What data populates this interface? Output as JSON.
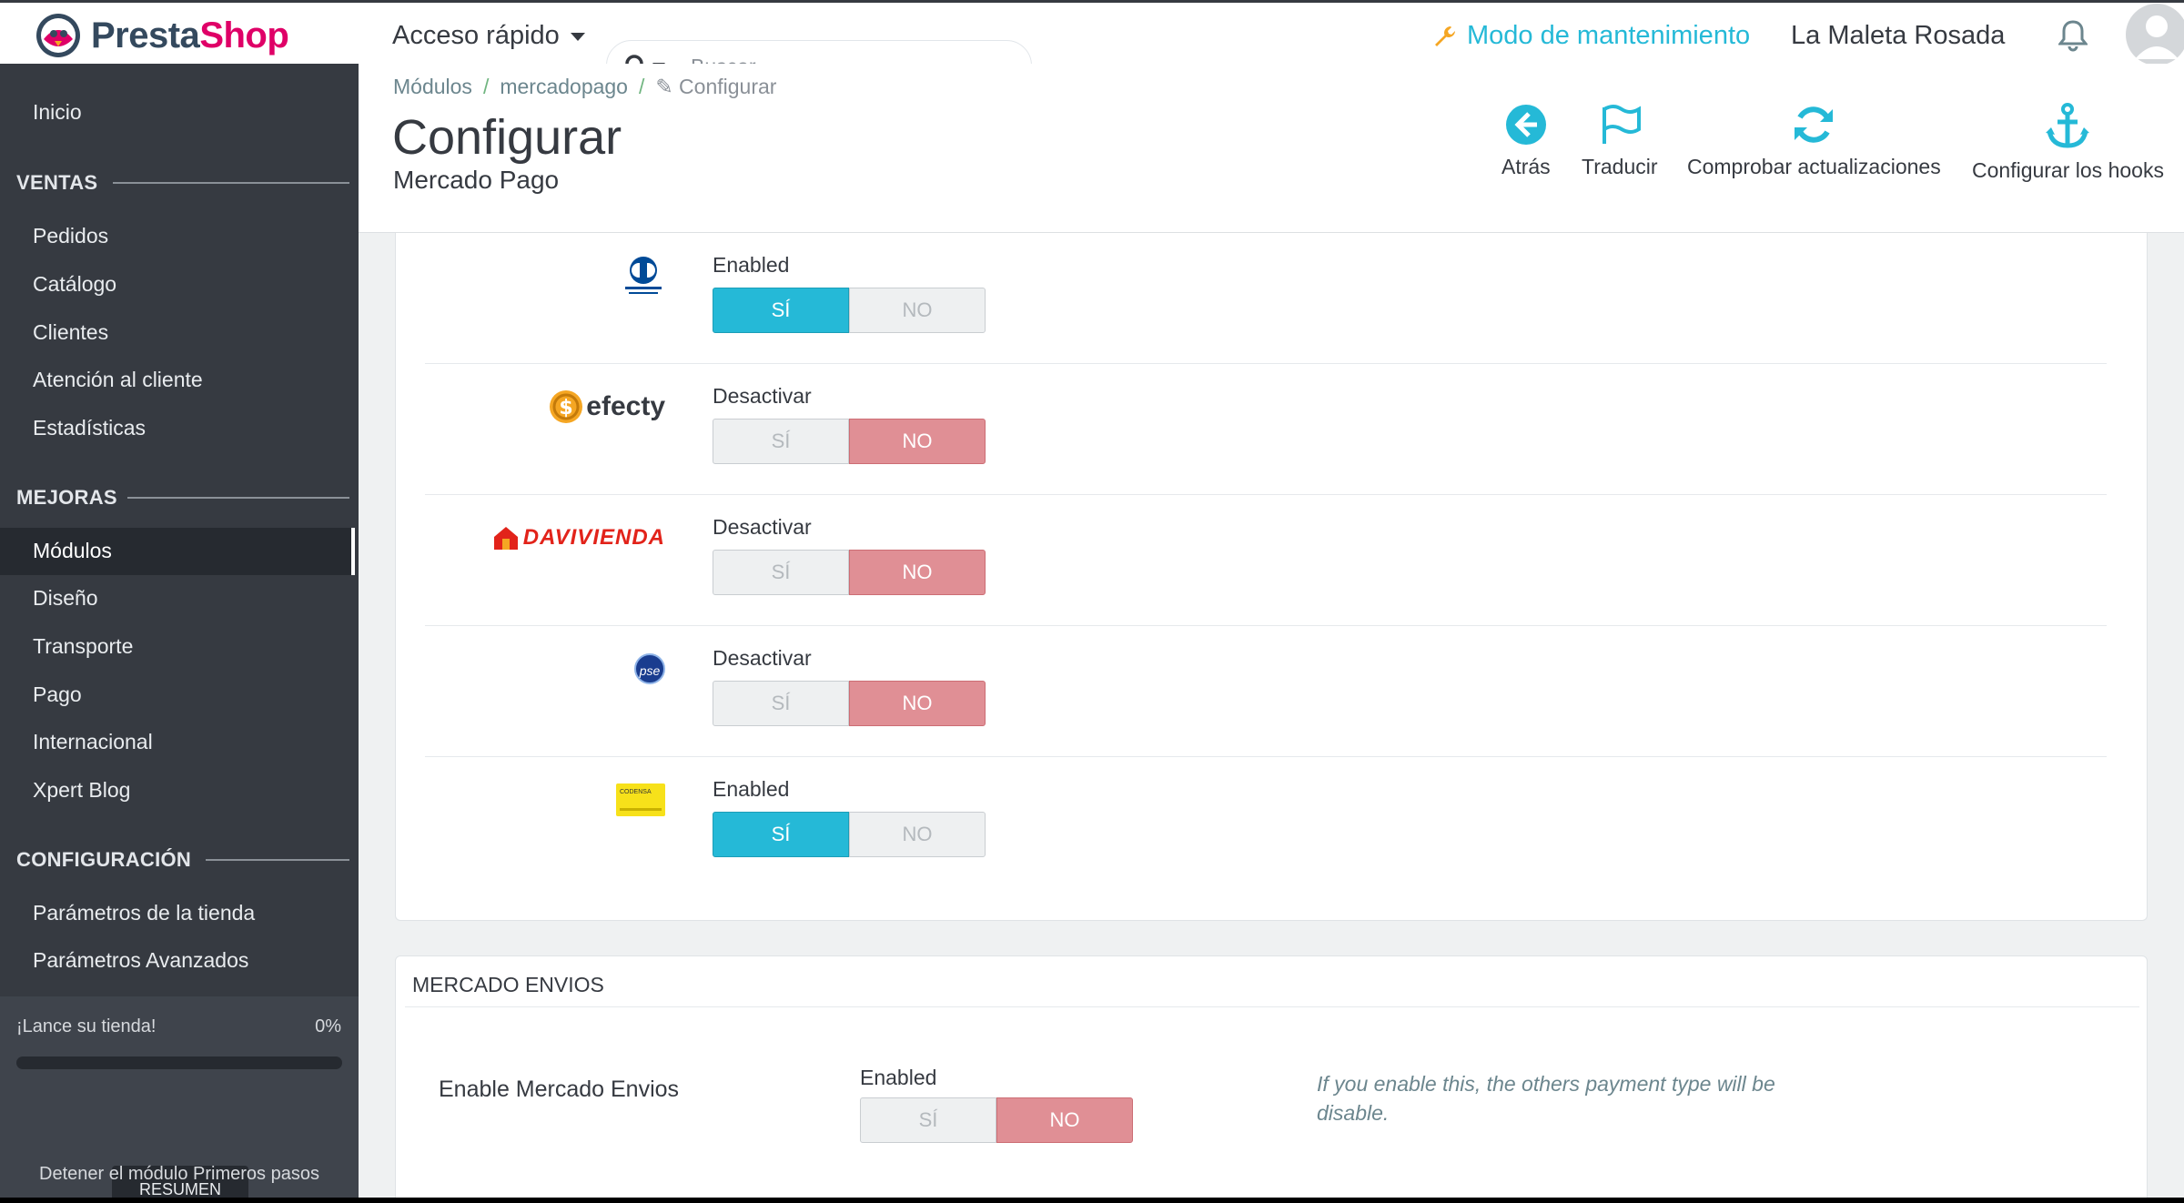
{
  "header": {
    "brand": {
      "part1": "Presta",
      "part2": "Shop"
    },
    "quick_access": "Acceso rápido",
    "search": {
      "placeholder": "Buscar"
    },
    "maintenance": "Modo de mantenimiento",
    "shop_name": "La Maleta Rosada"
  },
  "sidebar": {
    "home": "Inicio",
    "sections": [
      {
        "title": "VENTAS",
        "items": [
          "Pedidos",
          "Catálogo",
          "Clientes",
          "Atención al cliente",
          "Estadísticas"
        ]
      },
      {
        "title": "MEJORAS",
        "items": [
          "Módulos",
          "Diseño",
          "Transporte",
          "Pago",
          "Internacional",
          "Xpert Blog"
        ]
      },
      {
        "title": "CONFIGURACIÓN",
        "items": [
          "Parámetros de la tienda",
          "Parámetros Avanzados"
        ]
      }
    ],
    "active_item": "Módulos",
    "launch": {
      "label": "¡Lance su tienda!",
      "percent_text": "0%",
      "progress": 0
    },
    "summary_button": "RESUMEN",
    "stop_link": "Detener el módulo Primeros pasos"
  },
  "page": {
    "breadcrumb": [
      "Módulos",
      "mercadopago",
      "Configurar"
    ],
    "title": "Configurar",
    "subtitle": "Mercado Pago",
    "toolbar": [
      {
        "label": "Atrás",
        "icon": "back-arrow-icon"
      },
      {
        "label": "Traducir",
        "icon": "flag-icon"
      },
      {
        "label": "Comprobar actualizaciones",
        "icon": "refresh-icon"
      },
      {
        "label": "Configurar los hooks",
        "icon": "anchor-icon"
      }
    ]
  },
  "payment_methods": [
    {
      "logo": "diners-club-logo",
      "status": "Enabled",
      "yes": "SÍ",
      "no": "NO",
      "value": "yes"
    },
    {
      "logo": "efecty-logo",
      "logo_text": "efecty",
      "status": "Desactivar",
      "yes": "SÍ",
      "no": "NO",
      "value": "no"
    },
    {
      "logo": "davivienda-logo",
      "logo_text": "DAVIVIENDA",
      "status": "Desactivar",
      "yes": "SÍ",
      "no": "NO",
      "value": "no"
    },
    {
      "logo": "pse-logo",
      "logo_text": "pse",
      "status": "Desactivar",
      "yes": "SÍ",
      "no": "NO",
      "value": "no"
    },
    {
      "logo": "codensa-logo",
      "logo_text": "CODENSA",
      "status": "Enabled",
      "yes": "SÍ",
      "no": "NO",
      "value": "yes"
    }
  ],
  "mercado_envios": {
    "panel_title": "MERCADO ENVIOS",
    "field_label": "Enable Mercado Envios",
    "status": "Enabled",
    "yes": "SÍ",
    "no": "NO",
    "value": "no",
    "help": "If you enable this, the others payment type will be disable."
  },
  "colors": {
    "accent": "#25b9d7",
    "brand_pink": "#df0067",
    "sidebar": "#363a41",
    "danger": "#e08f95"
  }
}
